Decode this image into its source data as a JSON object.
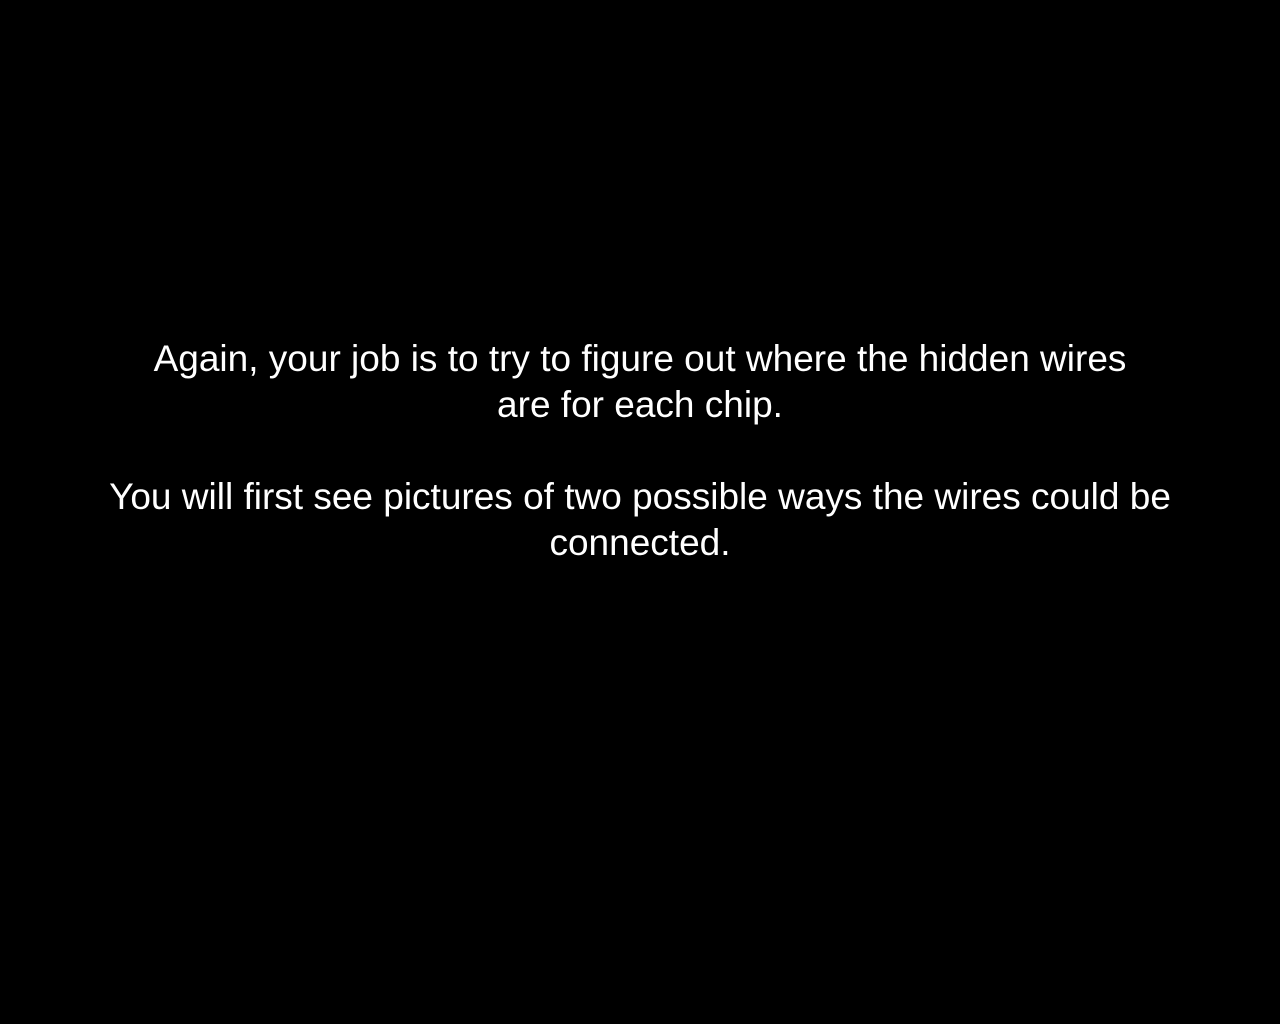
{
  "instructions": {
    "paragraph_1": {
      "line_1": "Again, your job is to try to figure out where the hidden wires",
      "line_2": "are for each chip."
    },
    "paragraph_2": {
      "line_1": "You will first see pictures of two possible ways the wires could be",
      "line_2": "connected."
    }
  },
  "colors": {
    "background": "#000000",
    "text": "#ffffff"
  }
}
